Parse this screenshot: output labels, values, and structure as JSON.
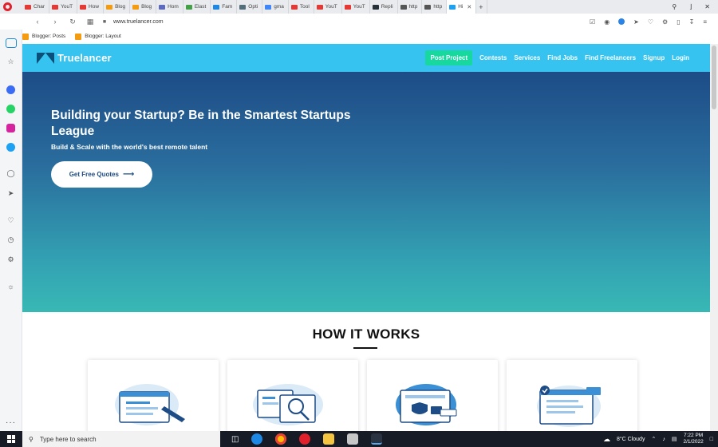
{
  "browser": {
    "tabs": [
      {
        "label": "Char",
        "color": "#e53935"
      },
      {
        "label": "YouT",
        "color": "#e53935"
      },
      {
        "label": "How",
        "color": "#e53935"
      },
      {
        "label": "Blog",
        "color": "#f39c12"
      },
      {
        "label": "Blog",
        "color": "#f39c12"
      },
      {
        "label": "Hom",
        "color": "#5c6bc0"
      },
      {
        "label": "Elast",
        "color": "#43a047"
      },
      {
        "label": "Fam",
        "color": "#1e88e5"
      },
      {
        "label": "Opti",
        "color": "#546e7a"
      },
      {
        "label": "gma",
        "color": "#4285f4"
      },
      {
        "label": "Tool",
        "color": "#e53935"
      },
      {
        "label": "YouT",
        "color": "#e53935"
      },
      {
        "label": "YouT",
        "color": "#e53935"
      },
      {
        "label": "Repli",
        "color": "#263238"
      },
      {
        "label": "http",
        "color": "#555555"
      },
      {
        "label": "http",
        "color": "#555555"
      },
      {
        "label": "Hi",
        "color": "#1da1f2"
      }
    ],
    "url": "www.truelancer.com",
    "bookmarks": [
      "Blogger: Posts",
      "Blogger: Layout"
    ]
  },
  "site": {
    "logo": "Truelancer",
    "nav": [
      "Post Project",
      "Contests",
      "Services",
      "Find Jobs",
      "Find Freelancers",
      "Signup",
      "Login"
    ],
    "hero": {
      "title": "Building your Startup? Be in the Smartest Startups League",
      "subtitle": "Build & Scale with the world's best remote talent",
      "cta": "Get Free Quotes",
      "cta_arrow": "⟶"
    },
    "how_title": "HOW IT WORKS"
  },
  "taskbar": {
    "search_placeholder": "Type here to search",
    "weather": "8°C  Cloudy",
    "time": "7:22 PM",
    "date": "2/1/2022"
  }
}
